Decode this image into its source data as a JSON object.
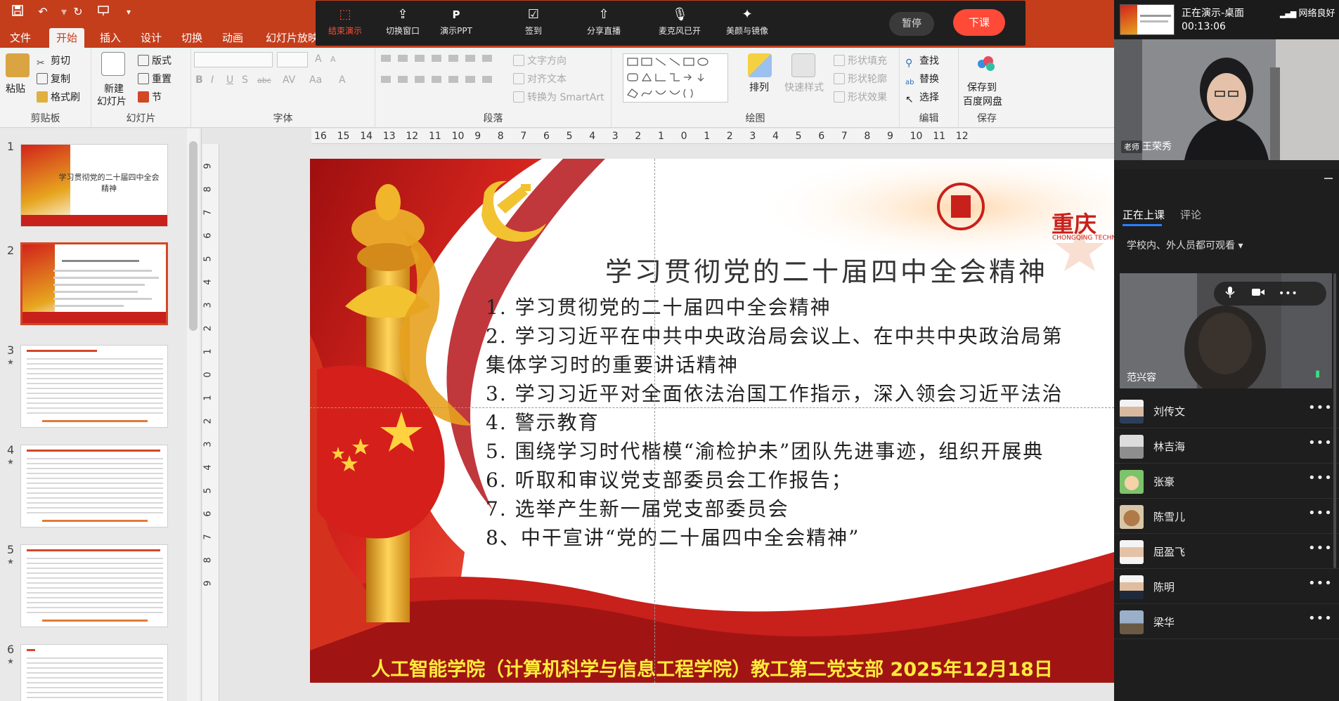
{
  "quick_access": {
    "icons": [
      "save-icon",
      "undo-icon",
      "redo-icon",
      "present-icon",
      "qat-more-icon"
    ]
  },
  "ribbon": {
    "tabs": [
      "文件",
      "开始",
      "插入",
      "设计",
      "切换",
      "动画",
      "幻灯片放映"
    ],
    "active_tab": "开始",
    "clipboard": {
      "paste": "粘贴",
      "cut": "剪切",
      "copy": "复制",
      "format_painter": "格式刷",
      "label": "剪贴板"
    },
    "slides": {
      "new_slide": "新建",
      "new_slide_2": "幻灯片",
      "layout": "版式",
      "reset": "重置",
      "section": "节",
      "label": "幻灯片"
    },
    "font": {
      "bold": "B",
      "italic": "I",
      "underline": "U",
      "shadow": "S",
      "strike": "abc",
      "spacing": "AV",
      "case": "Aa",
      "color": "A",
      "grow": "A",
      "shrink": "A",
      "label": "字体"
    },
    "paragraph": {
      "text_direction": "文字方向",
      "align_text": "对齐文本",
      "smartart": "转换为 SmartArt",
      "label": "段落"
    },
    "drawing": {
      "arrange": "排列",
      "quick_styles": "快速样式",
      "shape_fill": "形状填充",
      "shape_outline": "形状轮廓",
      "shape_effects": "形状效果",
      "label": "绘图"
    },
    "editing": {
      "find": "查找",
      "replace": "替换",
      "select": "选择",
      "label": "编辑"
    },
    "save": {
      "save_to": "保存到",
      "netdisk": "百度网盘",
      "label": "保存"
    }
  },
  "presenter_toolbar": {
    "buttons": [
      {
        "label": "结束演示",
        "icon": "stop-share-icon",
        "active": true
      },
      {
        "label": "切换窗口",
        "icon": "switch-window-icon",
        "active": false
      },
      {
        "label": "演示PPT",
        "icon": "ppt-icon",
        "active": false
      },
      {
        "label": "签到",
        "icon": "checkin-icon",
        "active": false
      },
      {
        "label": "分享直播",
        "icon": "share-icon",
        "active": false
      },
      {
        "label": "麦克风已开",
        "icon": "mic-icon",
        "active": false
      },
      {
        "label": "美颜与镜像",
        "icon": "beauty-icon",
        "active": false
      }
    ],
    "pause": "暂停",
    "end_class": "下课",
    "accent": "#ff4a38"
  },
  "thumbnails": {
    "items": [
      {
        "num": "1",
        "starred": false,
        "title": "学习贯彻党的二十届四中全会精神"
      },
      {
        "num": "2",
        "starred": false,
        "title": ""
      },
      {
        "num": "3",
        "starred": true,
        "title": ""
      },
      {
        "num": "4",
        "starred": true,
        "title": ""
      },
      {
        "num": "5",
        "starred": true,
        "title": ""
      },
      {
        "num": "6",
        "starred": true,
        "title": ""
      }
    ],
    "star_glyph": "★"
  },
  "rulers": {
    "horizontal": [
      "16",
      "15",
      "14",
      "13",
      "12",
      "11",
      "10",
      "9",
      "8",
      "7",
      "6",
      "5",
      "4",
      "3",
      "2",
      "1",
      "0",
      "1",
      "2",
      "3",
      "4",
      "5",
      "6",
      "7",
      "8",
      "9",
      "10",
      "11",
      "12"
    ],
    "vertical": [
      "9",
      "8",
      "7",
      "6",
      "5",
      "4",
      "3",
      "2",
      "1",
      "0",
      "1",
      "2",
      "3",
      "4",
      "5",
      "6",
      "7",
      "8",
      "9"
    ]
  },
  "slide": {
    "title": "学习贯彻党的二十届四中全会精神",
    "items": [
      "1. 学习贯彻党的二十届四中全会精神",
      "2. 学习习近平在中共中央政治局会议上、在中共中央政治局第",
      "集体学习时的重要讲话精神",
      "3. 学习习近平对全面依法治国工作指示，深入领会习近平法治",
      "4. 警示教育",
      "5. 围绕学习时代楷模“渝检护未”团队先进事迹，组织开展典",
      "6. 听取和审议党支部委员会工作报告；",
      "7. 选举产生新一届党支部委员会",
      "8、中干宣讲“党的二十届四中全会精神”"
    ],
    "footer": "人工智能学院（计算机科学与信息工程学院）教工第二党支部 2025年12月18日",
    "logo_text": "重庆",
    "logo_sub": "CHONGQING TECHNO",
    "colors": {
      "red": "#c8201b",
      "gold": "#f2c230",
      "footer_text": "#ffeb3b"
    }
  },
  "live": {
    "status": "正在演示-桌面",
    "duration": "00:13:06",
    "network": "网络良好",
    "teacher_tag": "老师",
    "teacher_name": "王荣秀"
  },
  "panel": {
    "tabs": [
      "正在上课",
      "评论"
    ],
    "active_tab": "正在上课",
    "visibility": "学校内、外人员都可观看 ▾",
    "featured_student": "范兴容",
    "members": [
      "刘传文",
      "林吉海",
      "张豪",
      "陈雪儿",
      "屈盈飞",
      "陈明",
      "梁华"
    ],
    "more_glyph": "•••"
  }
}
